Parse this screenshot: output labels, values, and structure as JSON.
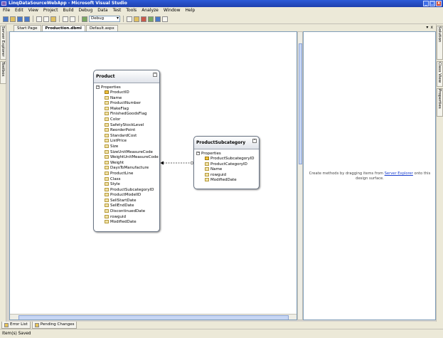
{
  "window": {
    "title": "LinqDataSourceWebApp - Microsoft Visual Studio",
    "min_glyph": "_",
    "max_glyph": "□",
    "close_glyph": "x"
  },
  "menu": [
    "File",
    "Edit",
    "View",
    "Project",
    "Build",
    "Debug",
    "Data",
    "Test",
    "Tools",
    "Analyze",
    "Window",
    "Help"
  ],
  "toolbar": {
    "config_value": "Debug"
  },
  "left_tabs": [
    "Server Explorer",
    "Toolbox"
  ],
  "right_tabs": [
    "Solution Explorer",
    "Class View",
    "Properties"
  ],
  "doc_tabs": [
    {
      "label": "Start Page",
      "active": false
    },
    {
      "label": "Production.dbml",
      "active": true
    },
    {
      "label": "Default.aspx",
      "active": false
    }
  ],
  "tab_controls": {
    "dropdown": "▾",
    "close": "x"
  },
  "entities": {
    "product": {
      "name": "Product",
      "section": "Properties",
      "properties": [
        "ProductID",
        "Name",
        "ProductNumber",
        "MakeFlag",
        "FinishedGoodsFlag",
        "Color",
        "SafetyStockLevel",
        "ReorderPoint",
        "StandardCost",
        "ListPrice",
        "Size",
        "SizeUnitMeasureCode",
        "WeightUnitMeasureCode",
        "Weight",
        "DaysToManufacture",
        "ProductLine",
        "Class",
        "Style",
        "ProductSubcategoryID",
        "ProductModelID",
        "SellStartDate",
        "SellEndDate",
        "DiscontinuedDate",
        "rowguid",
        "ModifiedDate"
      ]
    },
    "subcategory": {
      "name": "ProductSubcategory",
      "section": "Properties",
      "properties": [
        "ProductSubcategoryID",
        "ProductCategoryID",
        "Name",
        "rowguid",
        "ModifiedDate"
      ]
    }
  },
  "method_pane": {
    "before": "Create methods by dragging items from",
    "link": "Server Explorer",
    "after": "onto this design surface."
  },
  "bottom_tabs": [
    "Error List",
    "Pending Changes"
  ],
  "status": "Item(s) Saved"
}
